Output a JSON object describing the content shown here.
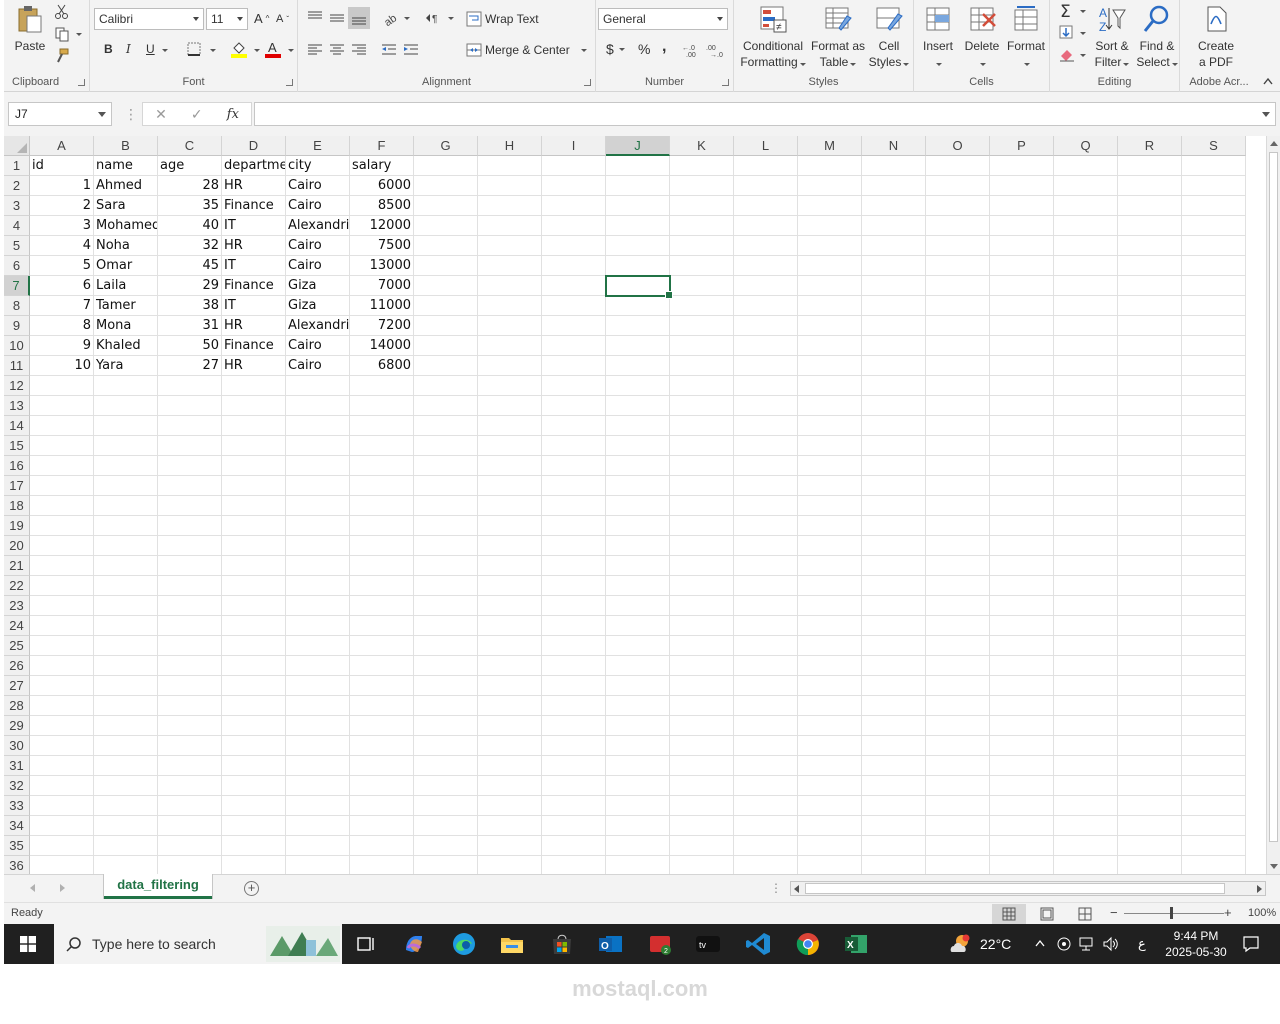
{
  "ribbon": {
    "clipboard": {
      "paste": "Paste",
      "label": "Clipboard"
    },
    "font": {
      "name": "Calibri",
      "size": "11",
      "bold": "B",
      "italic": "I",
      "underline": "U",
      "label": "Font"
    },
    "alignment": {
      "wrap": "Wrap Text",
      "merge": "Merge & Center",
      "label": "Alignment"
    },
    "number": {
      "format": "General",
      "currency": "$",
      "percent": "%",
      "comma": ",",
      "label": "Number"
    },
    "styles": {
      "conditional": [
        "Conditional",
        "Formatting"
      ],
      "format_table": [
        "Format as",
        "Table"
      ],
      "cell_styles": [
        "Cell",
        "Styles"
      ],
      "label": "Styles"
    },
    "cells": {
      "insert": "Insert",
      "delete": "Delete",
      "format": "Format",
      "label": "Cells"
    },
    "editing": {
      "sort": [
        "Sort &",
        "Filter"
      ],
      "find": [
        "Find &",
        "Select"
      ],
      "label": "Editing"
    },
    "adobe": {
      "create": [
        "Create",
        "a PDF"
      ],
      "label": "Adobe Acr..."
    }
  },
  "formula_bar": {
    "name_box": "J7",
    "fx": "fx",
    "cancel": "✕",
    "enter": "✓",
    "formula": ""
  },
  "columns": [
    "A",
    "B",
    "C",
    "D",
    "E",
    "F",
    "G",
    "H",
    "I",
    "J",
    "K",
    "L",
    "M",
    "N",
    "O",
    "P",
    "Q",
    "R",
    "S"
  ],
  "selected": {
    "col": "J",
    "row": 7
  },
  "row_count": 36,
  "headers": [
    "id",
    "name",
    "age",
    "departme",
    "city",
    "salary"
  ],
  "rows": [
    [
      "1",
      "Ahmed",
      "28",
      "HR",
      "Cairo",
      "6000"
    ],
    [
      "2",
      "Sara",
      "35",
      "Finance",
      "Cairo",
      "8500"
    ],
    [
      "3",
      "Mohamed",
      "40",
      "IT",
      "Alexandri",
      "12000"
    ],
    [
      "4",
      "Noha",
      "32",
      "HR",
      "Cairo",
      "7500"
    ],
    [
      "5",
      "Omar",
      "45",
      "IT",
      "Cairo",
      "13000"
    ],
    [
      "6",
      "Laila",
      "29",
      "Finance",
      "Giza",
      "7000"
    ],
    [
      "7",
      "Tamer",
      "38",
      "IT",
      "Giza",
      "11000"
    ],
    [
      "8",
      "Mona",
      "31",
      "HR",
      "Alexandri",
      "7200"
    ],
    [
      "9",
      "Khaled",
      "50",
      "Finance",
      "Cairo",
      "14000"
    ],
    [
      "10",
      "Yara",
      "27",
      "HR",
      "Cairo",
      "6800"
    ]
  ],
  "numeric_cols": [
    0,
    2,
    5
  ],
  "sheet_tabs": [
    {
      "name": "data_filtering",
      "active": true
    }
  ],
  "status": {
    "text": "Ready",
    "zoom": "100%",
    "zoom_minus": "−",
    "zoom_plus": "+"
  },
  "taskbar": {
    "search_placeholder": "Type here to search",
    "weather": "22°C",
    "time": "9:44 PM",
    "date": "2025-05-30",
    "lang": "ع"
  },
  "watermark": "mostaql.com",
  "colors": {
    "accent": "#217346",
    "taskbar": "#202020"
  }
}
